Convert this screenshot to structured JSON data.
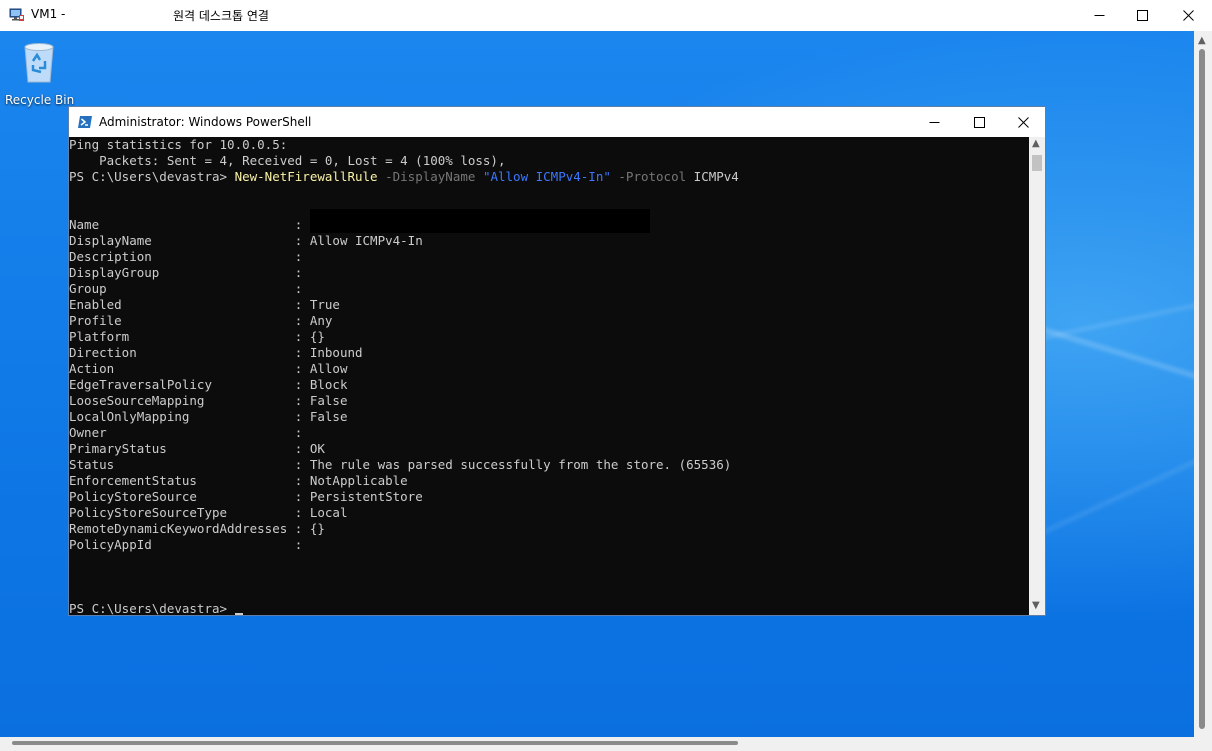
{
  "rdp": {
    "title": "VM1 -",
    "subtitle": "원격 데스크톱 연결"
  },
  "desktop": {
    "recycle_bin_label": "Recycle Bin"
  },
  "powershell": {
    "title": "Administrator: Windows PowerShell",
    "ping_line1": "Ping statistics for 10.0.0.5:",
    "ping_line2": "    Packets: Sent = 4, Received = 0, Lost = 4 (100% loss),",
    "prompt": "PS C:\\Users\\devastra> ",
    "cmd": "New-NetFirewallRule",
    "param1": " -DisplayName ",
    "value1": "\"Allow ICMPv4-In\"",
    "param2": " -Protocol ",
    "value2": "ICMPv4",
    "properties": [
      {
        "key": "Name                          ",
        "value": ""
      },
      {
        "key": "DisplayName                   ",
        "value": "Allow ICMPv4-In"
      },
      {
        "key": "Description                   ",
        "value": ""
      },
      {
        "key": "DisplayGroup                  ",
        "value": ""
      },
      {
        "key": "Group                         ",
        "value": ""
      },
      {
        "key": "Enabled                       ",
        "value": "True"
      },
      {
        "key": "Profile                       ",
        "value": "Any"
      },
      {
        "key": "Platform                      ",
        "value": "{}"
      },
      {
        "key": "Direction                     ",
        "value": "Inbound"
      },
      {
        "key": "Action                        ",
        "value": "Allow"
      },
      {
        "key": "EdgeTraversalPolicy           ",
        "value": "Block"
      },
      {
        "key": "LooseSourceMapping            ",
        "value": "False"
      },
      {
        "key": "LocalOnlyMapping              ",
        "value": "False"
      },
      {
        "key": "Owner                         ",
        "value": ""
      },
      {
        "key": "PrimaryStatus                 ",
        "value": "OK"
      },
      {
        "key": "Status                        ",
        "value": "The rule was parsed successfully from the store. (65536)"
      },
      {
        "key": "EnforcementStatus             ",
        "value": "NotApplicable"
      },
      {
        "key": "PolicyStoreSource             ",
        "value": "PersistentStore"
      },
      {
        "key": "PolicyStoreSourceType         ",
        "value": "Local"
      },
      {
        "key": "RemoteDynamicKeywordAddresses ",
        "value": "{}"
      },
      {
        "key": "PolicyAppId                   ",
        "value": ""
      }
    ],
    "final_prompt": "PS C:\\Users\\devastra> "
  },
  "icons": {
    "rdp_app": "remote-desktop-icon",
    "ps_app": "powershell-icon",
    "recycle": "recycle-bin-icon"
  },
  "colors": {
    "console_bg": "#0c0c0c",
    "console_fg": "#cccccc",
    "cmdlet": "#f9f1a5",
    "parameter": "#767676",
    "string": "#3b78ff",
    "desktop": "#0f79e6"
  }
}
